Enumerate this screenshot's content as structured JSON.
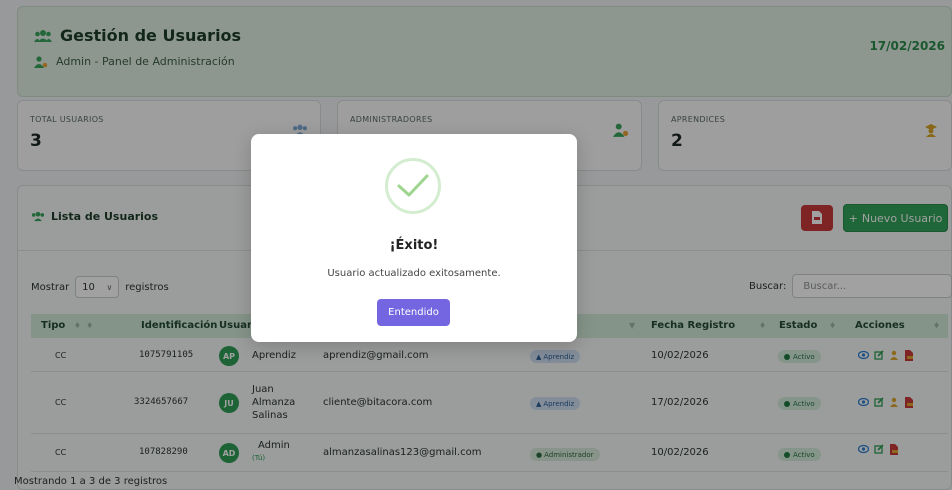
{
  "header": {
    "title": "Gestión de Usuarios",
    "subtitle": "Admin - Panel de Administración",
    "date": "17/02/2026"
  },
  "stats": [
    {
      "label": "TOTAL USUARIOS",
      "value": "3",
      "icon": "users-icon"
    },
    {
      "label": "ADMINISTRADORES",
      "value": "",
      "icon": "user-gear-icon"
    },
    {
      "label": "APRENDICES",
      "value": "2",
      "icon": "graduate-icon"
    }
  ],
  "list": {
    "title": "Lista de Usuarios",
    "new_user_label": "Nuevo Usuario",
    "show_label": "Mostrar",
    "page_size": "10",
    "records_label": "registros",
    "search_label": "Buscar:",
    "search_placeholder": "Buscar...",
    "columns": {
      "tipo": "Tipo",
      "identificacion": "Identificación",
      "usuario": "Usuario",
      "fecha": "Fecha Registro",
      "estado": "Estado",
      "acciones": "Acciones"
    },
    "rows": [
      {
        "tipo": "CC",
        "id": "1075791105",
        "initials": "AP",
        "name": "Aprendiz",
        "email": "aprendiz@gmail.com",
        "role": "Aprendiz",
        "date": "10/02/2026",
        "status": "Activo"
      },
      {
        "tipo": "CC",
        "id": "3324657667",
        "initials": "JU",
        "name": "Juan Almanza Salinas",
        "name_lines": [
          "Juan",
          "Almanza",
          "Salinas"
        ],
        "email": "cliente@bitacora.com",
        "role": "Aprendiz",
        "date": "17/02/2026",
        "status": "Activo"
      },
      {
        "tipo": "CC",
        "id": "107828290",
        "initials": "AD",
        "name": "Admin",
        "name_sub": "(Tú)",
        "email": "almanzasalinas123@gmail.com",
        "role": "Administrador",
        "date": "10/02/2026",
        "status": "Activo"
      }
    ],
    "footer": "Mostrando 1 a 3 de 3 registros"
  },
  "modal": {
    "title": "¡Éxito!",
    "message": "Usuario actualizado exitosamente.",
    "button": "Entendido"
  },
  "colors": {
    "accent_green": "#31a25a",
    "modal_button": "#7366e0",
    "pdf_red": "#c93a3a"
  }
}
